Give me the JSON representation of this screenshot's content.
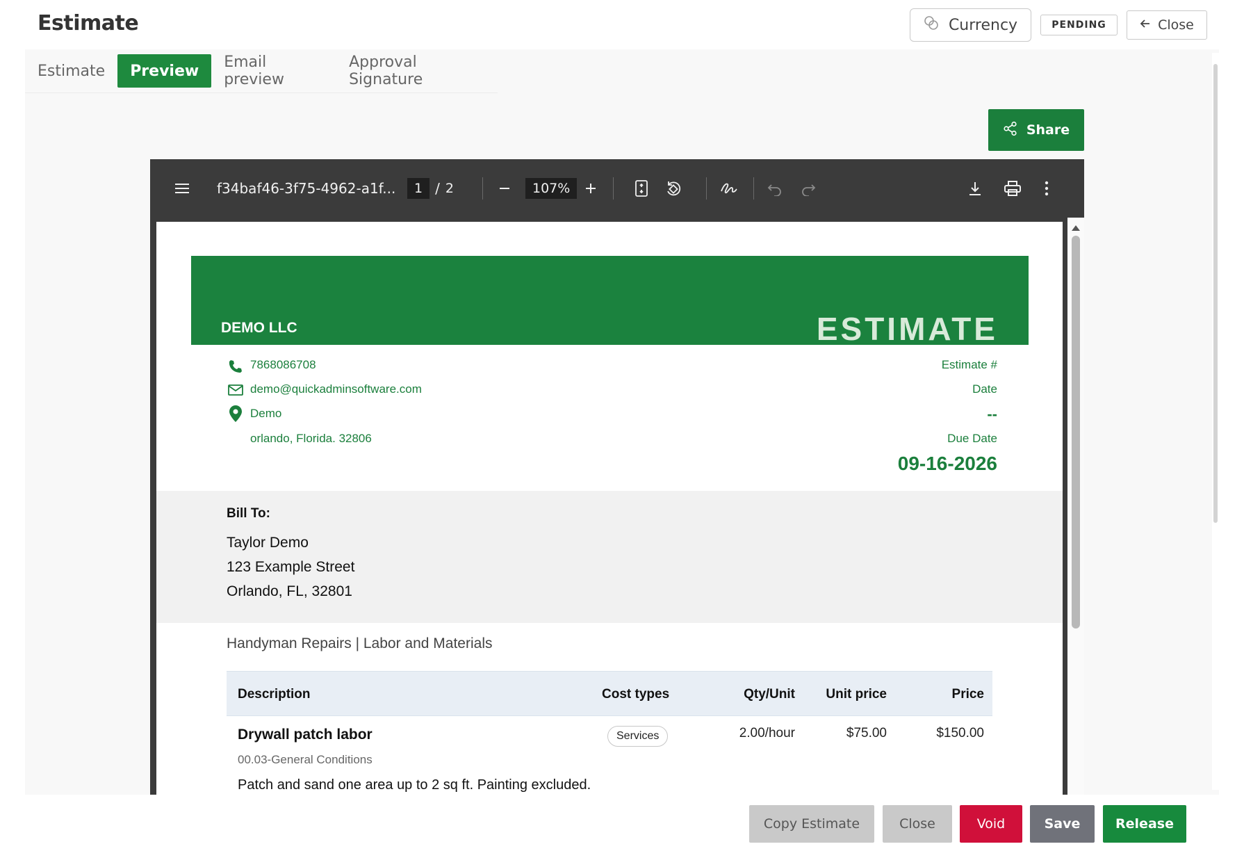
{
  "header": {
    "title": "Estimate",
    "currency_label": "Currency",
    "status_badge": "PENDING",
    "close_label": "Close"
  },
  "tabs": [
    {
      "label": "Estimate",
      "active": false
    },
    {
      "label": "Preview",
      "active": true
    },
    {
      "label": "Email preview",
      "active": false
    },
    {
      "label": "Approval Signature",
      "active": false
    }
  ],
  "share_label": "Share",
  "viewer": {
    "file_name": "f34baf46-3f75-4962-a1f...",
    "page_current": "1",
    "page_separator": "/",
    "page_total": "2",
    "zoom": "107%"
  },
  "document": {
    "company": "DEMO LLC",
    "heading": "ESTIMATE",
    "phone": "7868086708",
    "email": "demo@quickadminsoftware.com",
    "address_line1": "Demo",
    "address_line2": "orlando, Florida. 32806",
    "estimate_no_label": "Estimate #",
    "date_label": "Date",
    "date_value": "--",
    "due_date_label": "Due Date",
    "due_date_value": "09-16-2026",
    "bill_to_label": "Bill To:",
    "bill_to": [
      "Taylor Demo",
      "123 Example Street",
      "Orlando, FL, 32801"
    ],
    "project_title": "Handyman Repairs | Labor and Materials",
    "table_headers": {
      "description": "Description",
      "cost_types": "Cost types",
      "qty_unit": "Qty/Unit",
      "unit_price": "Unit price",
      "price": "Price"
    },
    "items": [
      {
        "name": "Drywall patch labor",
        "code": "00.03-General Conditions",
        "note": "Patch and sand one area up to 2 sq ft. Painting excluded.",
        "cost_type": "Services",
        "qty_unit": "2.00/hour",
        "unit_price": "$75.00",
        "price": "$150.00"
      }
    ]
  },
  "footer": {
    "copy_label": "Copy Estimate",
    "close_label": "Close",
    "void_label": "Void",
    "save_label": "Save",
    "release_label": "Release"
  },
  "colors": {
    "brand_green": "#1b823e",
    "void_red": "#d0103a",
    "viewer_bar": "#3b3b3b"
  }
}
